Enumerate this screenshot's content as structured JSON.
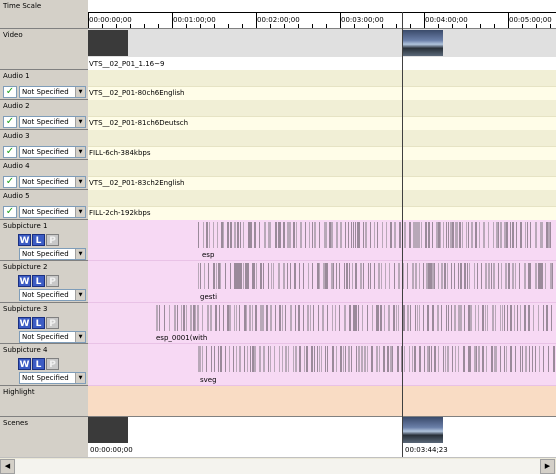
{
  "tracks_panel": {
    "time_scale": "Time Scale",
    "video": "Video",
    "audio": [
      {
        "label": "Audio 1",
        "language": "Not Specified",
        "clip": "VTS__02_P01-80ch6English"
      },
      {
        "label": "Audio 2",
        "language": "Not Specified",
        "clip": "VTS__02_P01-81ch6Deutsch"
      },
      {
        "label": "Audio 3",
        "language": "Not Specified",
        "clip": "FILL-6ch-384kbps"
      },
      {
        "label": "Audio 4",
        "language": "Not Specified",
        "clip": "VTS__02_P01-83ch2English"
      },
      {
        "label": "Audio 5",
        "language": "Not Specified",
        "clip": "FILL-2ch-192kbps"
      }
    ],
    "subpictures": [
      {
        "label": "Subpicture 1",
        "language": "Not Specified",
        "clip": "esp"
      },
      {
        "label": "Subpicture 2",
        "language": "Not Specified",
        "clip": "gesti"
      },
      {
        "label": "Subpicture 3",
        "language": "Not Specified",
        "clip": "esp_0001(with"
      },
      {
        "label": "Subpicture 4",
        "language": "Not Specified",
        "clip": "sveg"
      }
    ],
    "highlight": "Highlight",
    "scenes": "Scenes"
  },
  "subpicture_buttons": {
    "w": "W",
    "l": "L",
    "p": "P"
  },
  "checkbox_glyph": "✓",
  "ruler": {
    "ticks": [
      "00:00:00;00",
      "00:01:00;00",
      "00:02:00;00",
      "00:03:00;00",
      "00:04:00;00",
      "00:05:00;00"
    ]
  },
  "video_clip": "VTS__02_P01_1.16~9",
  "scene_markers": {
    "first": "00:00:00;00",
    "second": "00:03:44;23"
  },
  "scroll": {
    "left": "◀",
    "right": "▶"
  },
  "colors": {
    "audio": "#f1efd6",
    "subpicture": "#f7d9f4",
    "highlight": "#f9dcc4",
    "accent": "#3c5cc4"
  }
}
